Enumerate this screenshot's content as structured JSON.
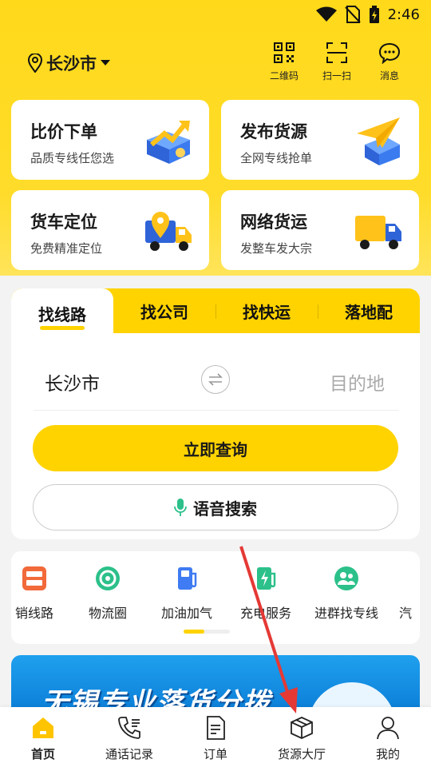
{
  "status_bar": {
    "time": "2:46"
  },
  "header": {
    "city": "长沙市",
    "actions": [
      {
        "label": "二维码",
        "icon": "qrcode-icon"
      },
      {
        "label": "扫一扫",
        "icon": "scan-icon"
      },
      {
        "label": "消息",
        "icon": "message-icon"
      }
    ]
  },
  "services": [
    {
      "title": "比价下单",
      "subtitle": "品质专线任您选",
      "icon": "price-compare-icon"
    },
    {
      "title": "发布货源",
      "subtitle": "全网专线抢单",
      "icon": "publish-cargo-icon"
    },
    {
      "title": "货车定位",
      "subtitle": "免费精准定位",
      "icon": "truck-location-icon"
    },
    {
      "title": "网络货运",
      "subtitle": "发整车发大宗",
      "icon": "network-freight-icon"
    }
  ],
  "search": {
    "tabs": [
      "找线路",
      "找公司",
      "找快运",
      "落地配"
    ],
    "active_tab": 0,
    "from": "长沙市",
    "to_placeholder": "目的地",
    "query_label": "立即查询",
    "voice_label": "语音搜索"
  },
  "quick_services": [
    {
      "label": "销线路",
      "icon": "quality-guarantee-icon"
    },
    {
      "label": "物流圈",
      "icon": "logistics-circle-icon"
    },
    {
      "label": "加油加气",
      "icon": "fuel-icon"
    },
    {
      "label": "充电服务",
      "icon": "charging-icon"
    },
    {
      "label": "进群找专线",
      "icon": "group-icon"
    },
    {
      "label": "汽",
      "icon": "car-icon"
    }
  ],
  "banner": {
    "text": "无锡专业落货分拨"
  },
  "bottom_nav": [
    {
      "label": "首页",
      "icon": "home-icon"
    },
    {
      "label": "通话记录",
      "icon": "phone-icon"
    },
    {
      "label": "订单",
      "icon": "order-icon"
    },
    {
      "label": "货源大厅",
      "icon": "cargo-box-icon"
    },
    {
      "label": "我的",
      "icon": "user-icon"
    }
  ],
  "colors": {
    "brand_yellow": "#ffd300",
    "banner_blue": "#1593e6",
    "annotation_red": "#e53935"
  }
}
